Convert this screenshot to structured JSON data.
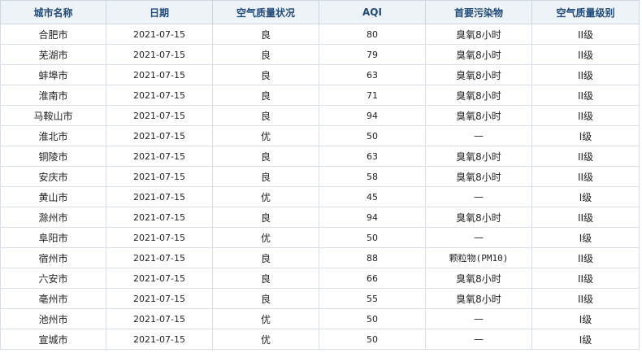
{
  "table": {
    "headers": [
      "城市名称",
      "日期",
      "空气质量状况",
      "AQI",
      "首要污染物",
      "空气质量级别"
    ],
    "rows": [
      {
        "city": "合肥市",
        "date": "2021-07-15",
        "status": "良",
        "aqi": "80",
        "pollutant": "臭氧8小时",
        "level": "II级"
      },
      {
        "city": "芜湖市",
        "date": "2021-07-15",
        "status": "良",
        "aqi": "79",
        "pollutant": "臭氧8小时",
        "level": "II级"
      },
      {
        "city": "蚌埠市",
        "date": "2021-07-15",
        "status": "良",
        "aqi": "63",
        "pollutant": "臭氧8小时",
        "level": "II级"
      },
      {
        "city": "淮南市",
        "date": "2021-07-15",
        "status": "良",
        "aqi": "71",
        "pollutant": "臭氧8小时",
        "level": "II级"
      },
      {
        "city": "马鞍山市",
        "date": "2021-07-15",
        "status": "良",
        "aqi": "94",
        "pollutant": "臭氧8小时",
        "level": "II级"
      },
      {
        "city": "淮北市",
        "date": "2021-07-15",
        "status": "优",
        "aqi": "50",
        "pollutant": "—",
        "level": "I级"
      },
      {
        "city": "铜陵市",
        "date": "2021-07-15",
        "status": "良",
        "aqi": "63",
        "pollutant": "臭氧8小时",
        "level": "II级"
      },
      {
        "city": "安庆市",
        "date": "2021-07-15",
        "status": "良",
        "aqi": "58",
        "pollutant": "臭氧8小时",
        "level": "II级"
      },
      {
        "city": "黄山市",
        "date": "2021-07-15",
        "status": "优",
        "aqi": "45",
        "pollutant": "—",
        "level": "I级"
      },
      {
        "city": "滁州市",
        "date": "2021-07-15",
        "status": "良",
        "aqi": "94",
        "pollutant": "臭氧8小时",
        "level": "II级"
      },
      {
        "city": "阜阳市",
        "date": "2021-07-15",
        "status": "优",
        "aqi": "50",
        "pollutant": "—",
        "level": "I级"
      },
      {
        "city": "宿州市",
        "date": "2021-07-15",
        "status": "良",
        "aqi": "88",
        "pollutant": "颗粒物(PM10)",
        "level": "II级"
      },
      {
        "city": "六安市",
        "date": "2021-07-15",
        "status": "良",
        "aqi": "66",
        "pollutant": "臭氧8小时",
        "level": "II级"
      },
      {
        "city": "亳州市",
        "date": "2021-07-15",
        "status": "良",
        "aqi": "55",
        "pollutant": "臭氧8小时",
        "level": "II级"
      },
      {
        "city": "池州市",
        "date": "2021-07-15",
        "status": "优",
        "aqi": "50",
        "pollutant": "—",
        "level": "I级"
      },
      {
        "city": "宣城市",
        "date": "2021-07-15",
        "status": "优",
        "aqi": "50",
        "pollutant": "—",
        "level": "I级"
      }
    ]
  },
  "colors": {
    "header_bg": "#eef3f8",
    "header_text": "#1f4a7a",
    "border": "#d9dfe6"
  }
}
